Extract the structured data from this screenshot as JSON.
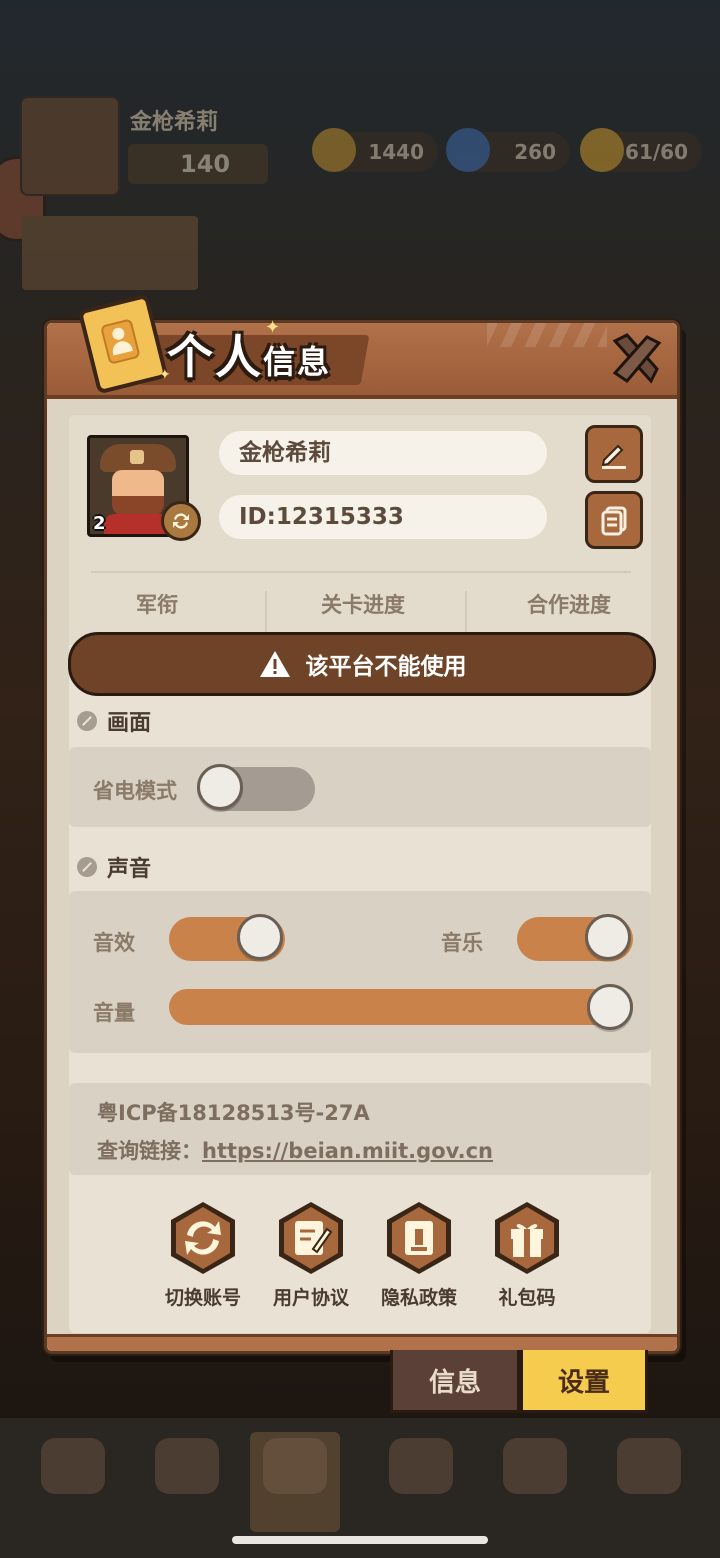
{
  "hud": {
    "player_name": "金枪希莉",
    "power": "140",
    "resources": [
      {
        "icon": "gold-coin-icon",
        "value": "1440"
      },
      {
        "icon": "blue-gem-icon",
        "value": "260"
      },
      {
        "icon": "energy-bolt-icon",
        "value": "61/60"
      }
    ]
  },
  "modal": {
    "title_main": "个人",
    "title_sub": "信息",
    "profile": {
      "name": "金枪希莉",
      "id": "ID:12315333",
      "level": "2",
      "stats": [
        "军衔",
        "关卡进度",
        "合作进度"
      ]
    },
    "warning": "该平台不能使用",
    "display_section": {
      "title": "画面",
      "power_save_label": "省电模式",
      "power_save_on": false
    },
    "sound_section": {
      "title": "声音",
      "sfx_label": "音效",
      "sfx_on": true,
      "music_label": "音乐",
      "music_on": true,
      "volume_label": "音量",
      "volume_percent": 100
    },
    "icp": {
      "record": "粤ICP备18128513号-27A",
      "query_label": "查询链接：",
      "query_url": "https://beian.miit.gov.cn"
    },
    "actions": [
      {
        "label": "切换账号",
        "icon": "switch-account-icon"
      },
      {
        "label": "用户协议",
        "icon": "user-agreement-icon"
      },
      {
        "label": "隐私政策",
        "icon": "privacy-policy-icon"
      },
      {
        "label": "礼包码",
        "icon": "gift-code-icon"
      }
    ]
  },
  "tabs": {
    "info": "信息",
    "settings": "设置",
    "active": "settings"
  },
  "colors": {
    "accent_brown": "#a8683d",
    "toggle_on": "#c9834a",
    "active_tab": "#f5cc4e"
  }
}
